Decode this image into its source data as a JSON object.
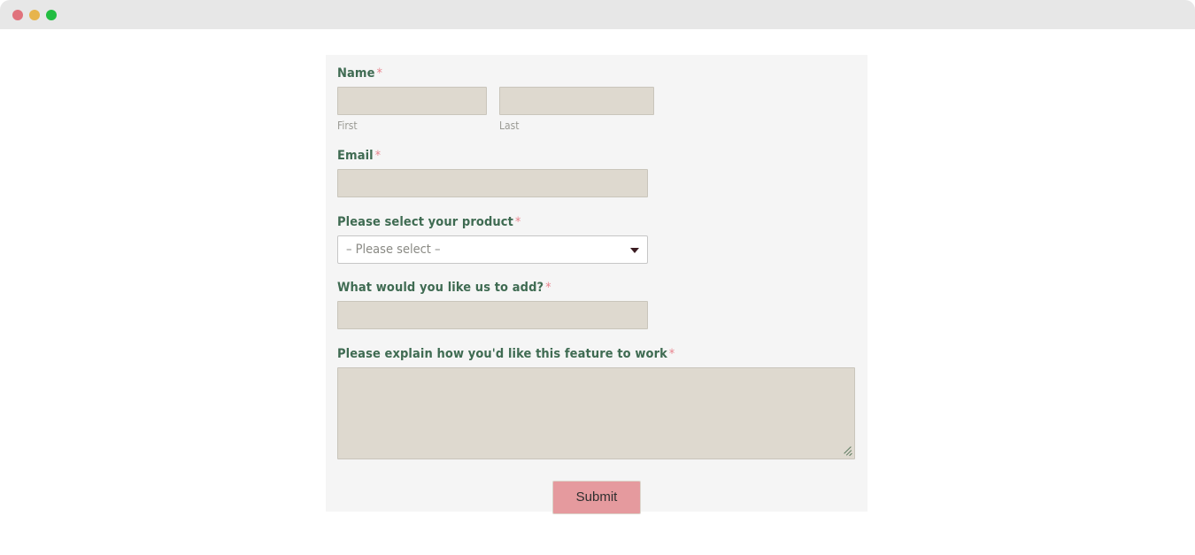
{
  "window": {
    "traffic_lights": [
      {
        "name": "close",
        "color": "#e0727c"
      },
      {
        "name": "minimize",
        "color": "#e7b44c"
      },
      {
        "name": "maximize",
        "color": "#22bd41"
      }
    ]
  },
  "form": {
    "required_marker": "*",
    "accent_color": "#e8828c",
    "label_color": "#3f6b52",
    "input_fill": "#ded9cf",
    "panel_bg": "#f5f5f5",
    "fields": {
      "name": {
        "label": "Name",
        "first": {
          "sub_label": "First",
          "value": "",
          "placeholder": ""
        },
        "last": {
          "sub_label": "Last",
          "value": "",
          "placeholder": ""
        }
      },
      "email": {
        "label": "Email",
        "value": "",
        "placeholder": ""
      },
      "product": {
        "label": "Please select your product",
        "selected": "– Please select –",
        "options": [
          "– Please select –"
        ]
      },
      "feature": {
        "label": "What would you like us to add?",
        "value": "",
        "placeholder": ""
      },
      "explain": {
        "label": "Please explain how you'd like this feature to work",
        "value": "",
        "placeholder": ""
      }
    },
    "submit": {
      "label": "Submit",
      "color": "#e59a9e"
    }
  }
}
